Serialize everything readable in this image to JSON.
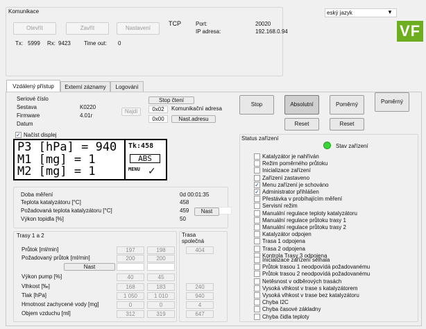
{
  "comm": {
    "title": "Komunikace",
    "open": "Otevřít",
    "close": "Zavřít",
    "settings": "Nastavení",
    "protocol": "TCP",
    "port_label": "Port:",
    "port_value": "20020",
    "ip_label": "IP adresa:",
    "ip_value": "192.168.0.94",
    "tx_label": "Tx:",
    "tx_value": "5999",
    "rx_label": "Rx:",
    "rx_value": "9423",
    "timeout_label": "Time out:",
    "timeout_value": "0"
  },
  "language": {
    "selected": "eský jazyk"
  },
  "logo": {
    "text": "VF",
    "bg": "#6cae1f"
  },
  "tabs": [
    {
      "label": "Vzdálený přístup"
    },
    {
      "label": "Externí záznamy"
    },
    {
      "label": "Logování"
    }
  ],
  "device": {
    "serial_label": "Seriové číslo",
    "assembly_label": "Sestava",
    "assembly_value": "K0220",
    "firmware_label": "Firmware",
    "firmware_value": "4.01r",
    "date_label": "Datum",
    "find_button": "Najdi",
    "stop_reading": "Stop čtení",
    "comm_address_value": "0x02",
    "comm_address_label": "Komunikační adresa",
    "set_address_value": "0x00",
    "set_address_button": "Nast.adresu"
  },
  "display": {
    "load_label": "Načíst displej",
    "checked": true,
    "lines": [
      "P3 [hPa] = 940",
      "M1 [mg] = 1",
      "M2 [mg] = 1"
    ],
    "side_top": "Tk:458",
    "side_mid": "ABS",
    "side_bottom": "MENU"
  },
  "controls": {
    "stop": "Stop",
    "absolute": "Absolutní",
    "proportional_1": "Poměrný",
    "proportional_2": "Poměrný",
    "reset_1": "Reset",
    "reset_2": "Reset"
  },
  "measurement": {
    "time_label": "Doba měření",
    "time_value": "0d 00:01:35",
    "cat_temp_label": "Teplota katalyzátoru [°C]",
    "cat_temp_value": "458",
    "req_temp_label": "Požadovaná teplota katalyzátoru [°C]",
    "req_temp_value": "459",
    "set_button": "Nast",
    "heater_label": "Výkon topidla [%]",
    "heater_value": "50"
  },
  "routes": {
    "header": "Trasy 1 a 2",
    "common_header": "Trasa společná",
    "set_button": "Nast",
    "rows": [
      {
        "label": "Průtok [ml/min]",
        "v1": "197",
        "v2": "198",
        "v3": "404"
      },
      {
        "label": "Požadovaný průtok [ml/min]",
        "v1": "200",
        "v2": "200",
        "v3": ""
      },
      {
        "label": "Výkon pump [%]",
        "v1": "40",
        "v2": "45",
        "v3": ""
      },
      {
        "label": "Vlhkost [‰]",
        "v1": "168",
        "v2": "183",
        "v3": "240"
      },
      {
        "label": "Tlak [hPa]",
        "v1": "1 050",
        "v2": "1 010",
        "v3": "940"
      },
      {
        "label": "Hmotnost zachycené vody [mg]",
        "v1": "0",
        "v2": "0",
        "v3": "4"
      },
      {
        "label": "Objem vzduchu [ml]",
        "v1": "312",
        "v2": "319",
        "v3": "647"
      }
    ]
  },
  "status": {
    "title": "Status zařízení",
    "device_state_label": "Stav zařízení",
    "device_state_color": "#39d438",
    "flags": [
      {
        "label": "Katalyzátor je nahříván",
        "checked": false
      },
      {
        "label": "Režim poměrného průtoku",
        "checked": false
      },
      {
        "label": "Inicializace zařízení",
        "checked": false
      },
      {
        "label": "Zařízení zastaveno",
        "checked": false
      },
      {
        "label": "Menu zařízení je schováno",
        "checked": true
      },
      {
        "label": "Administrator přihlášen",
        "checked": true
      },
      {
        "label": "Přestávka v probíhajícím měření",
        "checked": false
      },
      {
        "label": "Servisní režim",
        "checked": false
      },
      {
        "label": "Manuální regulace teploty katalyzátoru",
        "checked": false
      },
      {
        "label": "Manuální regulace průtoku trasy 1",
        "checked": false
      },
      {
        "label": "Manuální regulace průtoku trasy 2",
        "checked": false
      },
      {
        "label": "Katalyzátor odpojen",
        "checked": false
      },
      {
        "label": "Trasa 1 odpojena",
        "checked": false
      },
      {
        "label": "Trasa 2 odpojena",
        "checked": false
      },
      {
        "label": "Kontrola Trasy 3 odpojena",
        "checked": false
      }
    ],
    "errors": [
      {
        "label": "Inicializace zařízení selhala",
        "checked": false
      },
      {
        "label": "Průtok trasou 1 neodpovídá požadovanému",
        "checked": false
      },
      {
        "label": "Průtok trasou 2 neodpovídá požadovanému",
        "checked": false
      },
      {
        "label": "Netěsnost v odběrových trasách",
        "checked": false
      },
      {
        "label": "Vysoká vlhkost v trase s katalyzátorem",
        "checked": false
      },
      {
        "label": "Vysoká vlhkost v trase bez katalyzátoru",
        "checked": false
      },
      {
        "label": "Chyba I2C",
        "checked": false
      },
      {
        "label": "Chyba časové základny",
        "checked": false
      },
      {
        "label": "Chyba čidla teploty",
        "checked": false
      }
    ]
  }
}
